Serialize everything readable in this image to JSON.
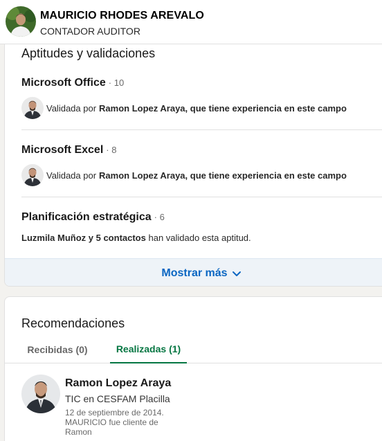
{
  "profile": {
    "name": "MAURICIO RHODES AREVALO",
    "headline": "CONTADOR AUDITOR"
  },
  "skills": {
    "section_title": "Aptitudes y validaciones",
    "items": [
      {
        "name": "Microsoft Office",
        "count": "· 10",
        "prefix": "Validada por",
        "endorser": "Ramon Lopez Araya, que tiene experiencia en este campo"
      },
      {
        "name": "Microsoft Excel",
        "count": "· 8",
        "prefix": "Validada por",
        "endorser": "Ramon Lopez Araya, que tiene experiencia en este campo"
      },
      {
        "name": "Planificación estratégica",
        "count": "· 6",
        "endorsers_bold": "Luzmila Muñoz y 5 contactos",
        "endorsers_rest": "han validado esta aptitud."
      }
    ],
    "show_more": "Mostrar más",
    "accent": "#0a66c2"
  },
  "recommendations": {
    "section_title": "Recomendaciones",
    "tabs": [
      {
        "label": "Recibidas (0)",
        "selected": false
      },
      {
        "label": "Realizadas (1)",
        "selected": true
      }
    ],
    "item": {
      "name": "Ramon Lopez Araya",
      "role": "TIC en CESFAM Placilla",
      "date": "12 de septiembre de 2014.",
      "relation": "MAURICIO fue cliente de Ramon"
    },
    "accent": "#057642"
  }
}
